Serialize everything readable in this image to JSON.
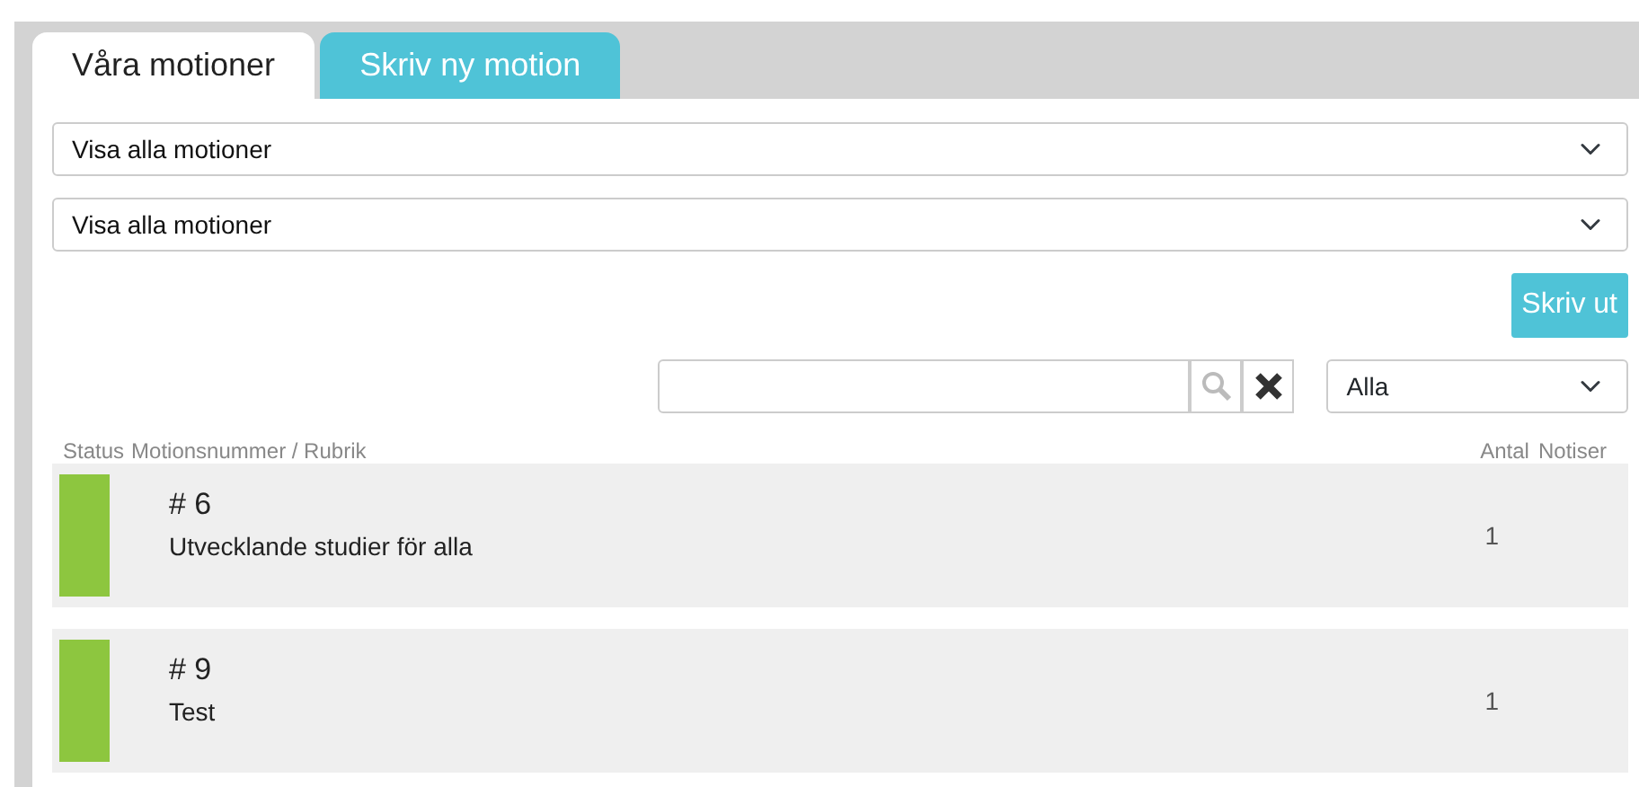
{
  "tabs": [
    {
      "label": "Våra motioner",
      "selected": true
    },
    {
      "label": "Skriv ny motion",
      "selected": false
    }
  ],
  "filters": [
    {
      "value": "Visa alla motioner"
    },
    {
      "value": "Visa alla motioner"
    }
  ],
  "print_button": "Skriv ut",
  "status_filter": {
    "value": "Alla"
  },
  "table": {
    "columns": [
      "Status",
      "Motionsnummer / Rubrik",
      "Antal",
      "Notiser"
    ],
    "rows": [
      {
        "color": "#8dc63f",
        "number": "# 6",
        "title": "Utvecklande studier för alla",
        "count": "1"
      },
      {
        "color": "#8dc63f",
        "number": "# 9",
        "title": "Test",
        "count": "1"
      }
    ]
  }
}
